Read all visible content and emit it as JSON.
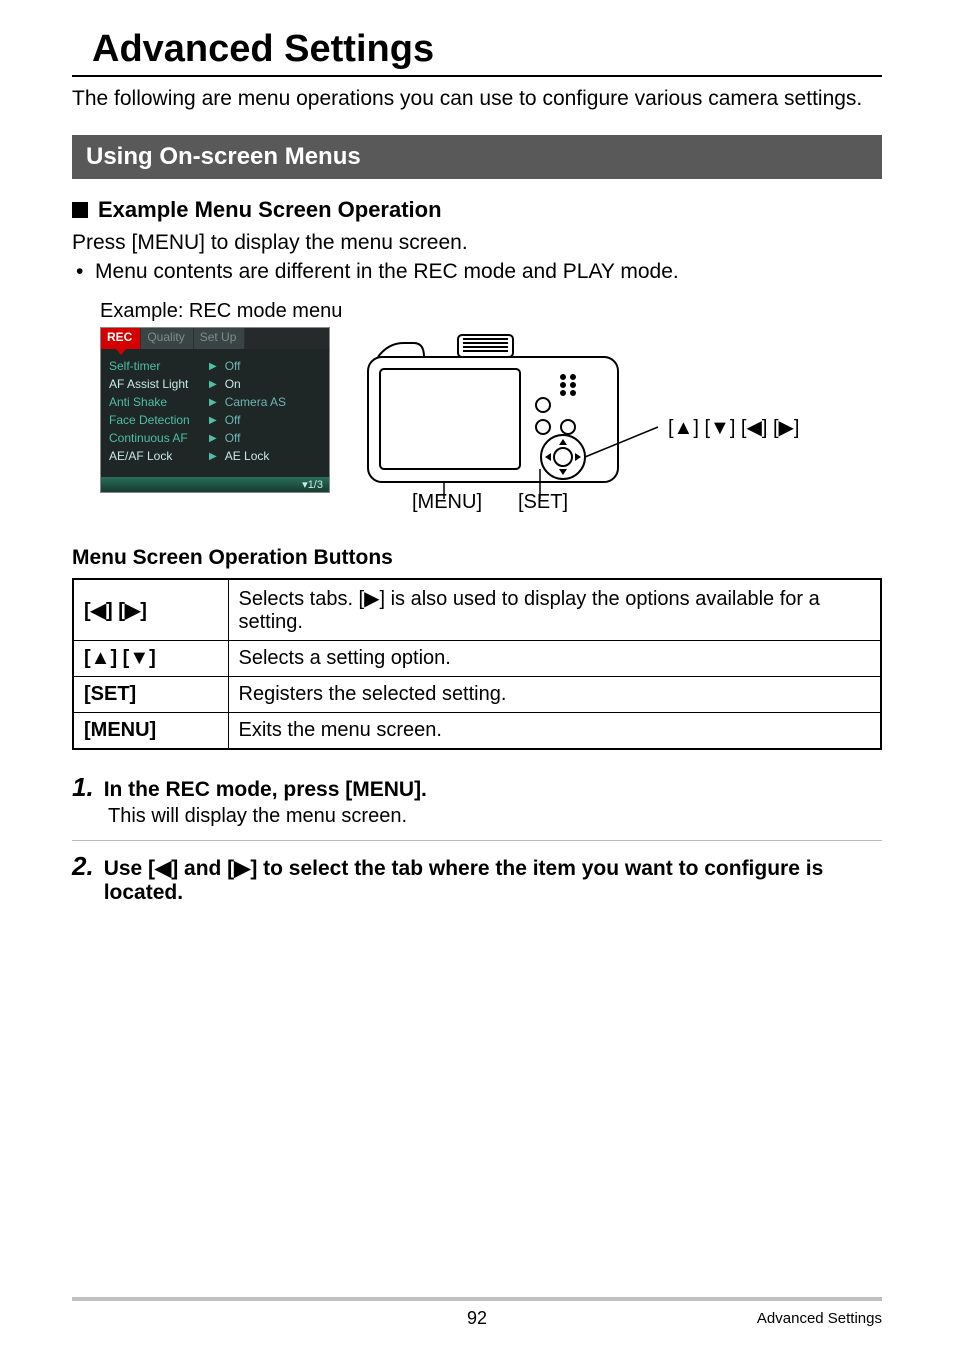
{
  "title": "Advanced Settings",
  "intro": "The following are menu operations you can use to configure various camera settings.",
  "section_bar": "Using On-screen Menus",
  "subsection": "Example Menu Screen Operation",
  "press_line": "Press [MENU] to display the menu screen.",
  "mode_note": "Menu contents are different in the REC mode and PLAY mode.",
  "example_label": "Example: REC mode menu",
  "menu_shot": {
    "tabs": [
      "REC",
      "Quality",
      "Set Up"
    ],
    "rows": [
      {
        "k": "Self-timer",
        "v": "Off",
        "hi": false
      },
      {
        "k": "AF Assist Light",
        "v": "On",
        "hi": true
      },
      {
        "k": "Anti Shake",
        "v": "Camera AS",
        "hi": false
      },
      {
        "k": "Face Detection",
        "v": "Off",
        "hi": false
      },
      {
        "k": "Continuous AF",
        "v": "Off",
        "hi": false
      },
      {
        "k": "AE/AF Lock",
        "v": "AE Lock",
        "hi": true
      }
    ],
    "pager": "▾1/3"
  },
  "camera_labels": {
    "menu": "[MENU]",
    "set": "[SET]",
    "dpad": "[▲] [▼] [◀] [▶]"
  },
  "ops_title": "Menu Screen Operation Buttons",
  "ops_table": [
    {
      "k": "[◀] [▶]",
      "v": "Selects tabs. [▶] is also used to display the options available for a setting."
    },
    {
      "k": "[▲] [▼]",
      "v": "Selects a setting option."
    },
    {
      "k": "[SET]",
      "v": "Registers the selected setting."
    },
    {
      "k": "[MENU]",
      "v": "Exits the menu screen."
    }
  ],
  "steps": [
    {
      "num": "1.",
      "title": "In the REC mode, press [MENU].",
      "body": "This will display the menu screen."
    },
    {
      "num": "2.",
      "title": "Use [◀] and [▶] to select the tab where the item you want to configure is located.",
      "body": ""
    }
  ],
  "footer": {
    "page": "92",
    "right": "Advanced Settings"
  }
}
